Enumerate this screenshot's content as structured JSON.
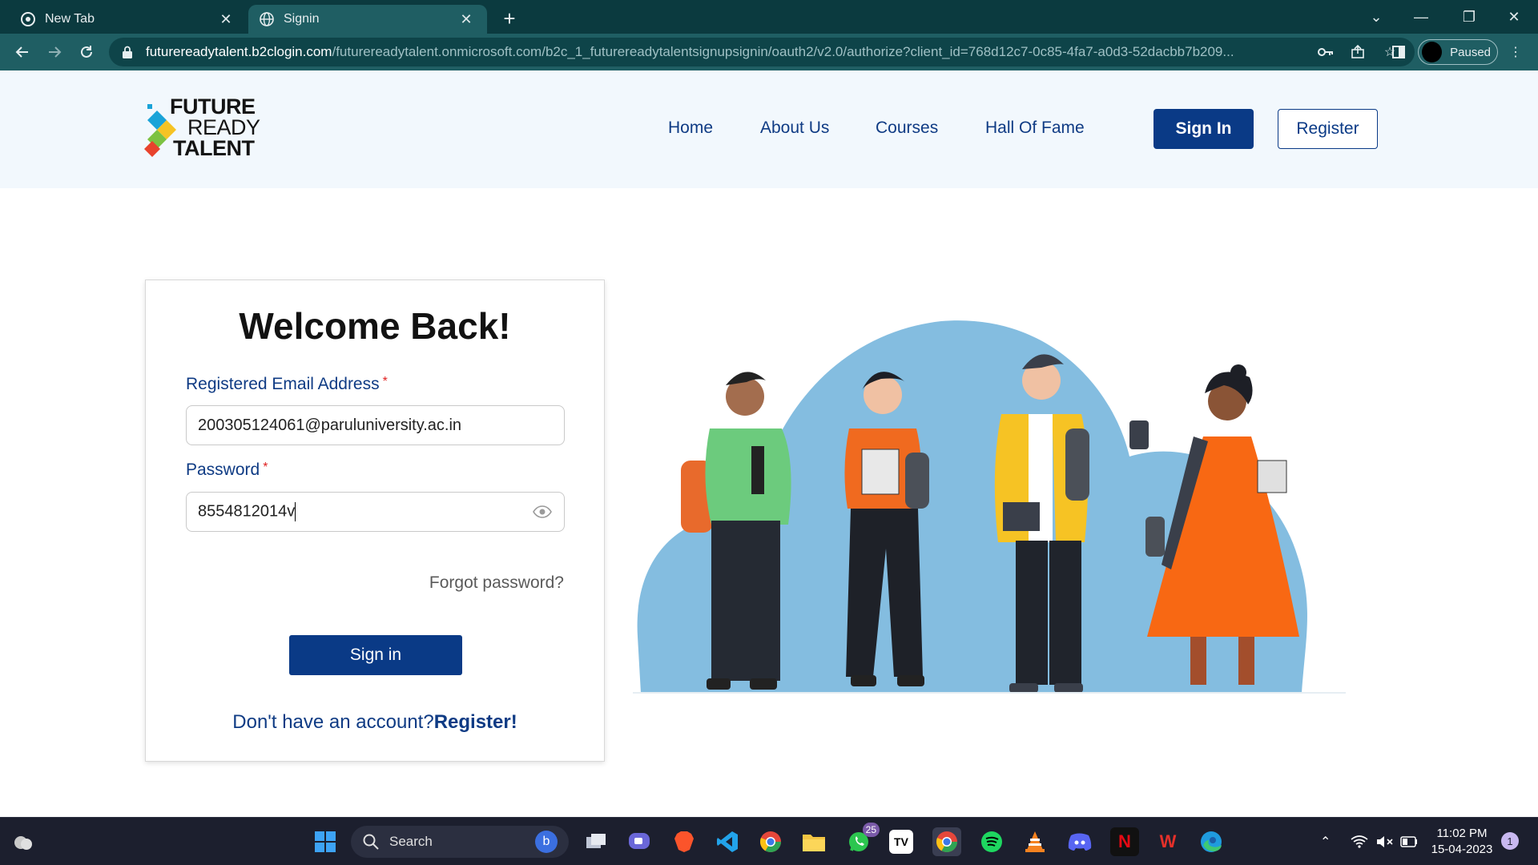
{
  "browser": {
    "tabs": [
      {
        "title": "New Tab",
        "active": false
      },
      {
        "title": "Signin",
        "active": true
      }
    ],
    "url_host": "futurereadytalent.b2clogin.com",
    "url_path": "/futurereadytalent.onmicrosoft.com/b2c_1_futurereadytalentsignupsignin/oauth2/v2.0/authorize?client_id=768d12c7-0c85-4fa7-a0d3-52dacbb7b209...",
    "profile_status": "Paused"
  },
  "site": {
    "logo": {
      "line1": "FUTURE",
      "line2": "READY",
      "line3": "TALENT"
    },
    "nav": [
      "Home",
      "About Us",
      "Courses",
      "Hall Of Fame"
    ],
    "signin_label": "Sign In",
    "register_label": "Register"
  },
  "login": {
    "title": "Welcome Back!",
    "email_label": "Registered Email Address",
    "email_value": "200305124061@paruluniversity.ac.in",
    "password_label": "Password",
    "password_value": "8554812014v",
    "required_mark": "*",
    "forgot": "Forgot password?",
    "submit": "Sign in",
    "no_account": "Don't have an account?",
    "register_link": "Register!"
  },
  "taskbar": {
    "search_placeholder": "Search",
    "whatsapp_badge": "25",
    "time": "11:02 PM",
    "date": "15-04-2023",
    "notifications": "1"
  },
  "colors": {
    "brand_blue": "#0a3a86",
    "header_bg": "#f2f8fd",
    "chrome_dark": "#0b3a3f",
    "chrome_toolbar": "#1f5e63",
    "illus_blue": "#84bde0"
  }
}
